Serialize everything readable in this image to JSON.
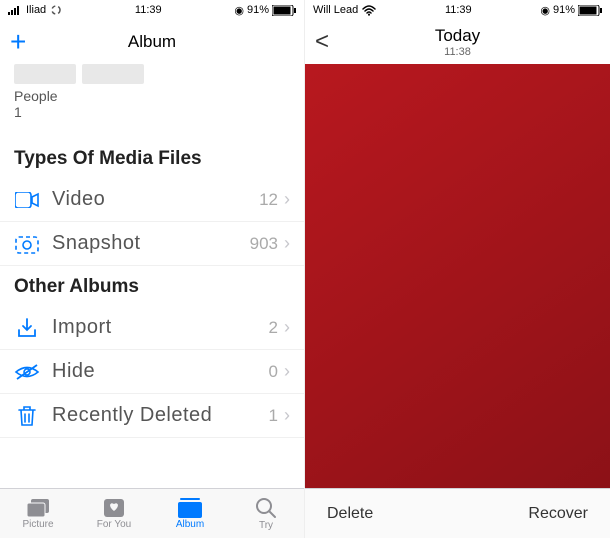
{
  "left": {
    "status": {
      "carrier": "Iliad",
      "time": "11:39",
      "battery": "91%"
    },
    "nav_title": "Album",
    "people": {
      "label": "People",
      "count": "1"
    },
    "section_media": "Types Of Media Files",
    "media_rows": [
      {
        "label": "Video",
        "count": "12"
      },
      {
        "label": "Snapshot",
        "count": "903"
      }
    ],
    "section_other": "Other Albums",
    "other_rows": [
      {
        "label": "Import",
        "count": "2"
      },
      {
        "label": "Hide",
        "count": "0"
      },
      {
        "label": "Recently Deleted",
        "count": "1"
      }
    ],
    "tabs": [
      {
        "label": "Picture"
      },
      {
        "label": "For You"
      },
      {
        "label": "Album"
      },
      {
        "label": "Try"
      }
    ]
  },
  "right": {
    "status": {
      "carrier": "Will Lead",
      "time": "11:39",
      "battery": "91%"
    },
    "nav_title": "Today",
    "nav_subtitle": "11:38",
    "bottom": {
      "delete": "Delete",
      "recover": "Recover"
    }
  }
}
